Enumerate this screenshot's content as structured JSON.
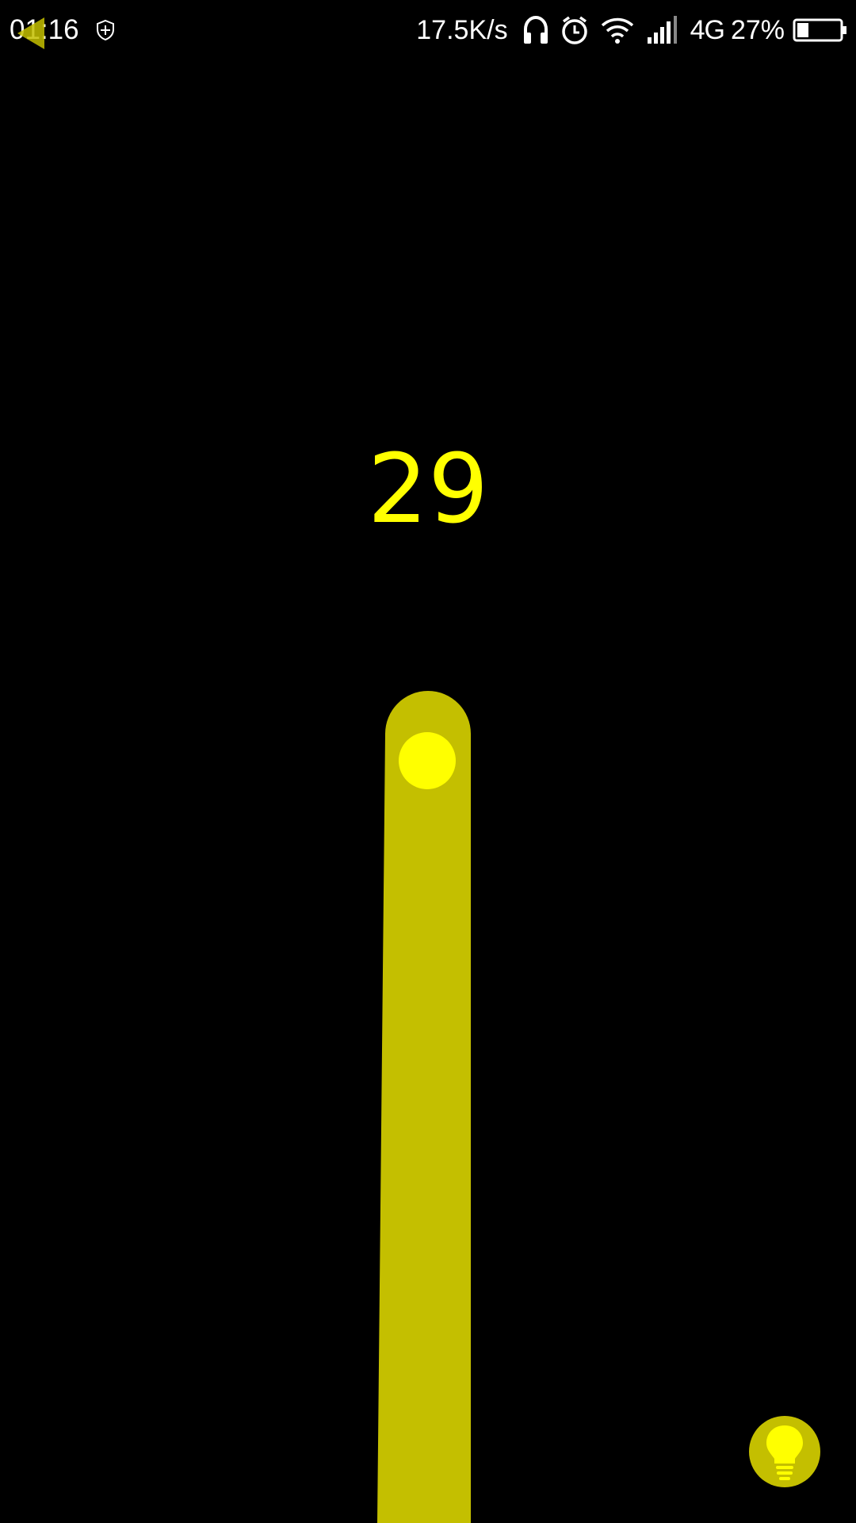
{
  "status_bar": {
    "time": "01:16",
    "network_speed": "17.5K/s",
    "network_type": "4G",
    "battery_percent": "27%",
    "battery_level": 0.27,
    "icons": [
      "shield-icon",
      "headphones-icon",
      "alarm-icon",
      "wifi-icon",
      "signal-icon",
      "battery-icon"
    ]
  },
  "game": {
    "score": "29",
    "colors": {
      "background": "#000000",
      "path": "#c4bf00",
      "ball": "#ffff00",
      "score": "#ffff00",
      "hint_button": "#c4bf00",
      "hint_icon": "#ffff00"
    }
  },
  "controls": {
    "back_icon": "back-arrow-icon",
    "hint_icon": "lightbulb-icon"
  }
}
